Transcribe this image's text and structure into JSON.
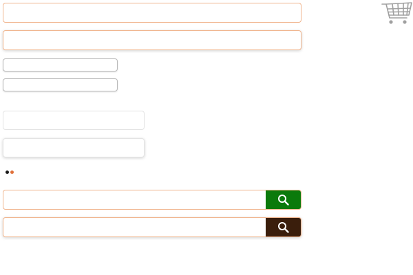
{
  "colors": {
    "accent_orange": "#f0b48c",
    "dot_dark": "#1a1a1a",
    "dot_orange": "#e0703a",
    "search_green": "#0b7a0b",
    "search_dark": "#3a1e0c",
    "icon_gray": "#a0a0a0"
  },
  "inputs": [
    {
      "value": "",
      "placeholder": ""
    },
    {
      "value": "",
      "placeholder": ""
    },
    {
      "value": "",
      "placeholder": ""
    },
    {
      "value": "",
      "placeholder": ""
    },
    {
      "value": "",
      "placeholder": ""
    },
    {
      "value": "",
      "placeholder": ""
    }
  ],
  "carousel": {
    "total": 2,
    "active": 1
  },
  "search_bars": [
    {
      "value": "",
      "placeholder": "",
      "button_color": "#0b7a0b",
      "icon": "search-icon"
    },
    {
      "value": "",
      "placeholder": "",
      "button_color": "#3a1e0c",
      "icon": "search-icon"
    }
  ],
  "header": {
    "cart_icon": "shopping-cart-icon"
  }
}
